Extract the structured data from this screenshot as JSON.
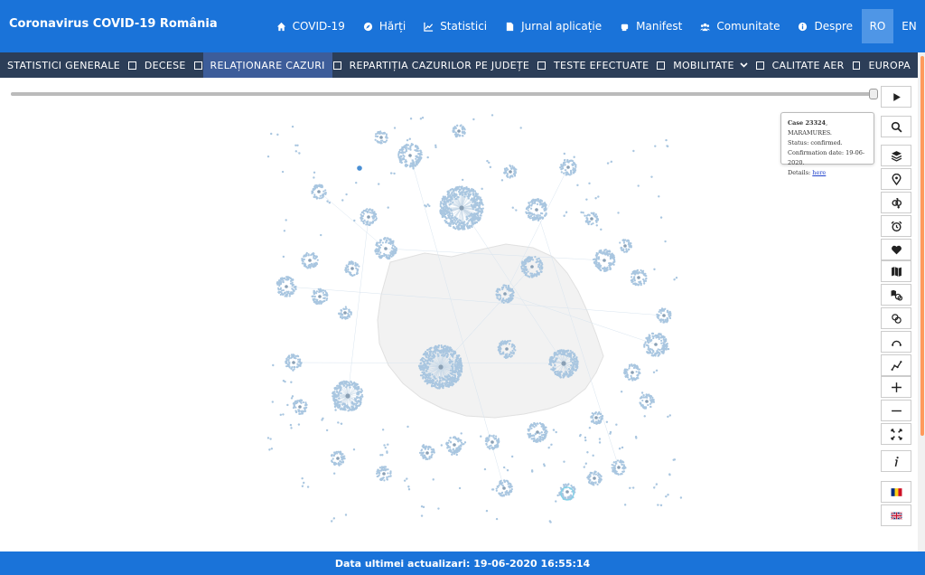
{
  "brand": "Coronavirus COVID-19 România",
  "topnav": {
    "items": [
      {
        "label": "COVID-19",
        "icon": "home-icon"
      },
      {
        "label": "Hărți",
        "icon": "compass-icon"
      },
      {
        "label": "Statistici",
        "icon": "chart-icon"
      },
      {
        "label": "Jurnal aplicație",
        "icon": "file-icon"
      },
      {
        "label": "Manifest",
        "icon": "fist-icon"
      },
      {
        "label": "Comunitate",
        "icon": "users-icon"
      },
      {
        "label": "Despre",
        "icon": "info-icon"
      }
    ],
    "lang_ro": "RO",
    "lang_en": "EN"
  },
  "subnav": {
    "tabs": [
      "STATISTICI GENERALE",
      "DECESE",
      "RELAȚIONARE CAZURI",
      "REPARTIȚIA CAZURILOR PE JUDEȚE",
      "TESTE EFECTUATE",
      "MOBILITATE",
      "CALITATE AER",
      "EUROPA"
    ],
    "active_index": 2
  },
  "timeline": {
    "progress": 1.0
  },
  "tooltip": {
    "case_label": "Case 23324",
    "county": ", MARAMURES.",
    "status": "Status: confirmed.",
    "confirmation": "Confirmation date: 19-06-2020.",
    "details_label": "Details: ",
    "details_link": "here"
  },
  "tools": [
    "play-icon",
    "search-icon",
    "layers-icon",
    "pin-icon",
    "gender-icon",
    "alarm-icon",
    "heart-icon",
    "map-icon",
    "map-circles-icon",
    "circles-icon",
    "arc-icon",
    "line-chart-icon",
    "zoom-in-icon",
    "zoom-out-icon",
    "fullscreen-icon",
    "info-italic-icon",
    "flag-ro-icon",
    "flag-uk-icon"
  ],
  "colors": {
    "primary": "#1a73d9",
    "subnav": "#2c3e58",
    "node": "#a9c6e0",
    "accent": "#ff9a5c"
  },
  "footer": "Data ultimei actualizari: 19-06-2020 16:55:14"
}
